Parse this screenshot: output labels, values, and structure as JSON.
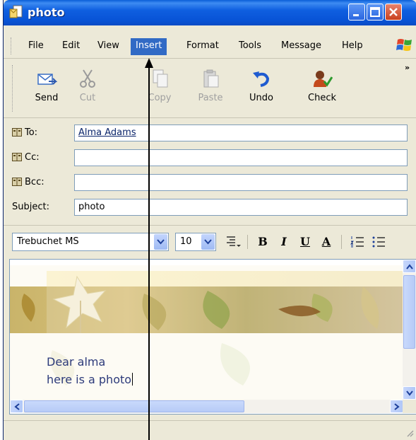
{
  "window": {
    "title": "photo"
  },
  "menu": [
    "File",
    "Edit",
    "View",
    "Insert",
    "Format",
    "Tools",
    "Message",
    "Help"
  ],
  "active_menu": "Insert",
  "toolbar": {
    "send": "Send",
    "cut": "Cut",
    "copy": "Copy",
    "paste": "Paste",
    "undo": "Undo",
    "check": "Check",
    "overflow": "»"
  },
  "fields": {
    "to_label": "To:",
    "to_value": "Alma Adams",
    "cc_label": "Cc:",
    "cc_value": "",
    "bcc_label": "Bcc:",
    "bcc_value": "",
    "subject_label": "Subject:",
    "subject_value": "photo"
  },
  "format": {
    "font": "Trebuchet MS",
    "size": "10",
    "bold": "B",
    "italic": "I",
    "underline": "U",
    "color": "A"
  },
  "message": {
    "line1": "Dear alma",
    "line2": "here is a photo"
  },
  "colors": {
    "selection": "#316ac5",
    "title_blue": "#0853d6",
    "close_red": "#c9401e"
  }
}
